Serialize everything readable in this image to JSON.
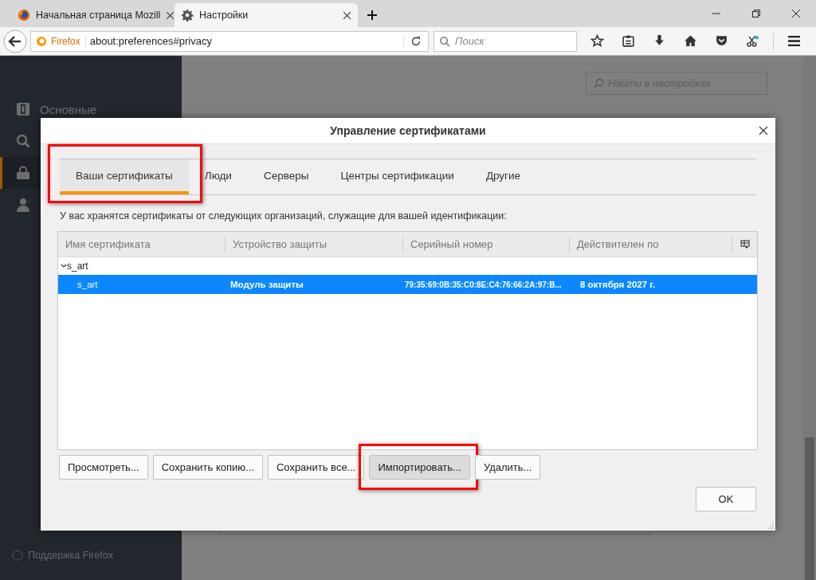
{
  "browser_tabs": [
    {
      "title": "Начальная страница Mozill",
      "selected": false
    },
    {
      "title": "Настройки",
      "selected": true
    }
  ],
  "toolbar": {
    "identity": "Firefox",
    "url": "about:preferences#privacy",
    "search": {
      "placeholder": "Поиск"
    }
  },
  "preferences": {
    "sidebar": {
      "items": [
        {
          "label": "Основные",
          "selected": false
        },
        {
          "selected": false
        },
        {
          "selected": true
        },
        {
          "selected": false
        }
      ],
      "footer": "Поддержка Firefox"
    },
    "search": {
      "placeholder": "Найти в настройках"
    }
  },
  "dialog": {
    "title": "Управление сертификатами",
    "tabs": [
      {
        "label": "Ваши сертификаты",
        "selected": true,
        "highlighted": true
      },
      {
        "label": "Люди",
        "selected": false,
        "highlighted": false
      },
      {
        "label": "Серверы",
        "selected": false,
        "highlighted": false
      },
      {
        "label": "Центры сертификации",
        "selected": false,
        "highlighted": false
      },
      {
        "label": "Другие",
        "selected": false,
        "highlighted": false
      }
    ],
    "description": "У вас хранятся сертификаты от следующих организаций, служащие для вашей идентификации:",
    "table": {
      "columns": [
        "Имя сертификата",
        "Устройство защиты",
        "Серийный номер",
        "Действителен по"
      ],
      "groups": [
        {
          "name": "s_art",
          "expanded": true,
          "rows": [
            {
              "cells": [
                "s_art",
                "Модуль защиты",
                "79:35:69:0B:35:C0:8E:C4:76:66:2A:97:B...",
                "8 октября 2027 г."
              ],
              "selected": true
            }
          ]
        }
      ]
    },
    "buttons": [
      {
        "label": "Просмотреть...",
        "highlighted": false
      },
      {
        "label": "Сохранить копию...",
        "highlighted": false
      },
      {
        "label": "Сохранить все...",
        "highlighted": false
      },
      {
        "label": "Импортировать...",
        "highlighted": true
      },
      {
        "label": "Удалить...",
        "highlighted": false
      }
    ],
    "ok": "OK"
  }
}
